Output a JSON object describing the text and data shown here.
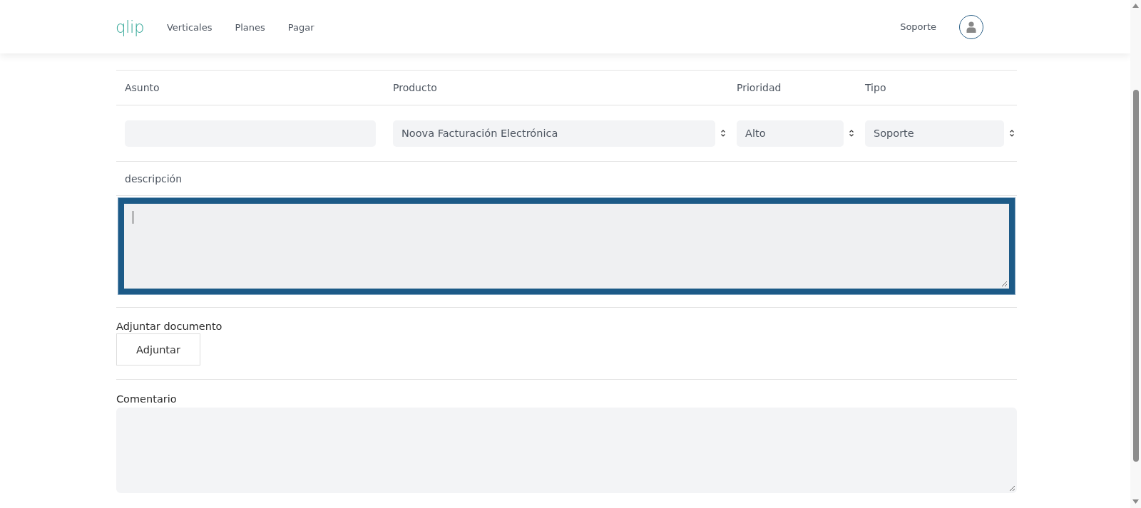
{
  "nav": {
    "logo": "qlip",
    "links": [
      {
        "label": "Verticales"
      },
      {
        "label": "Planes"
      },
      {
        "label": "Pagar"
      }
    ],
    "support": "Soporte"
  },
  "table": {
    "columns": [
      "Asunto",
      "Producto",
      "Prioridad",
      "Tipo"
    ],
    "fields": [
      {
        "kind": "input"
      },
      {
        "kind": "select",
        "value": "Noova Facturación Electrónica"
      },
      {
        "kind": "select",
        "value": "Alto"
      },
      {
        "kind": "select",
        "value": "Soporte"
      }
    ]
  },
  "description": {
    "label": "descripción",
    "focused": true
  },
  "attachment": {
    "label": "Adjuntar documento",
    "button": "Adjuntar"
  },
  "comment": {
    "label": "Comentario"
  }
}
